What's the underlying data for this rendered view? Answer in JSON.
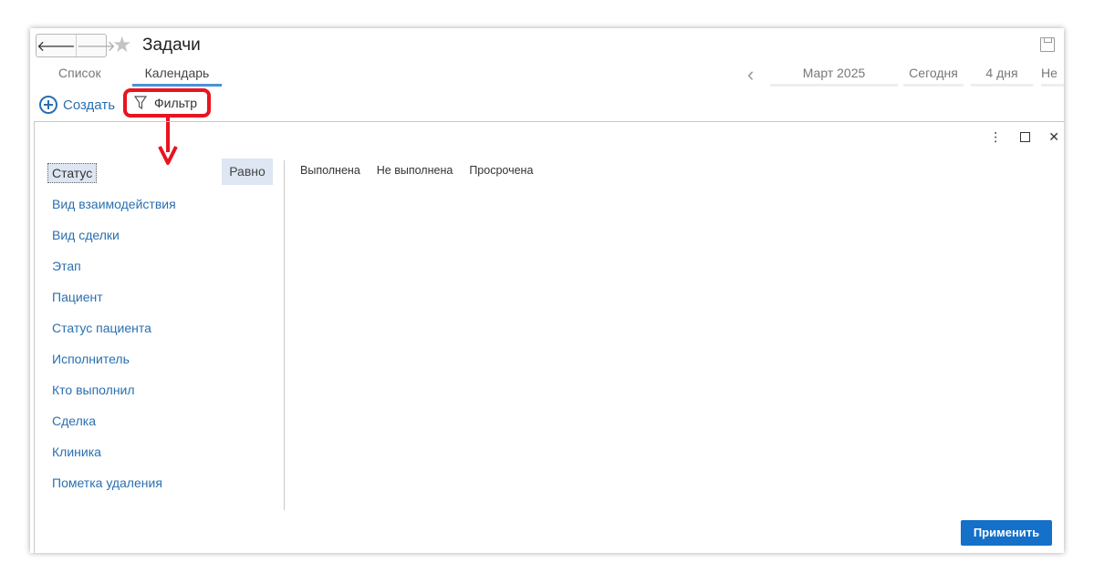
{
  "header": {
    "title": "Задачи",
    "back_icon": "arrow-left-icon",
    "forward_icon": "arrow-right-icon",
    "favorite_icon": "star-icon",
    "save_icon": "save-icon"
  },
  "tabs": [
    {
      "label": "Список"
    },
    {
      "label": "Календарь"
    }
  ],
  "calendar": {
    "month": "Март 2025",
    "today": "Сегодня",
    "period": "4 дня",
    "week": "Не"
  },
  "toolbar": {
    "create_label": "Создать",
    "filter_label": "Фильтр"
  },
  "filter_panel": {
    "fields": [
      "Статус",
      "Вид взаимодействия",
      "Вид сделки",
      "Этап",
      "Пациент",
      "Статус пациента",
      "Исполнитель",
      "Кто выполнил",
      "Сделка",
      "Клиника",
      "Пометка удаления"
    ],
    "comparison": "Равно",
    "values": [
      "Выполнена",
      "Не выполнена",
      "Просрочена"
    ],
    "apply_label": "Применить"
  },
  "colors": {
    "accent": "#1470c8",
    "link": "#2a6fb0",
    "highlight": "#e8141f"
  }
}
